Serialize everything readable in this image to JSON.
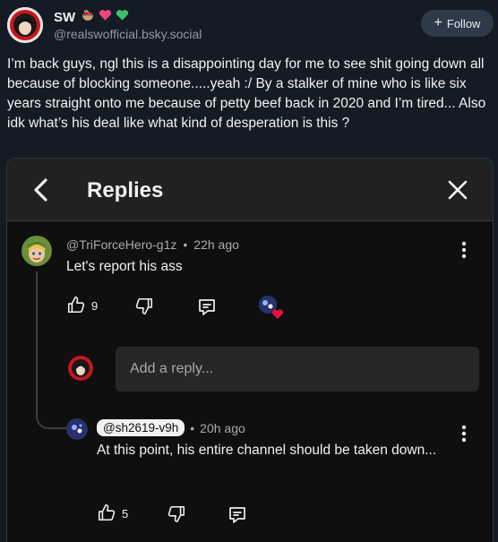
{
  "post": {
    "display_name": "SW",
    "emoji": [
      "ramen-bowl-emoji",
      "pink-heart-emoji",
      "green-heart-emoji"
    ],
    "handle": "@realswofficial.bsky.social",
    "follow_label": "Follow",
    "text": "I’m back guys, ngl this is a disappointing day for me to see shit going down all because of blocking someone.....yeah :/ By a stalker of mine who is like six years straight onto me because of petty beef back in 2020 and I’m tired... Also idk what’s his deal like what kind of desperation is this ?"
  },
  "embed": {
    "header_title": "Replies",
    "comments": [
      {
        "author": "@TriForceHero-g1z",
        "separator": "•",
        "time": "22h ago",
        "text": "Let's report his ass",
        "likes": "9"
      }
    ],
    "reply_input": {
      "placeholder": "Add a reply..."
    },
    "replies": [
      {
        "author": "@sh2619-v9h",
        "separator": "•",
        "time": "20h ago",
        "text": "At this point, his entire channel should be taken down...",
        "likes": "5"
      }
    ]
  },
  "colors": {
    "page_bg": "#141b24",
    "embed_bg": "#0f0f0f",
    "header_bg": "#212121",
    "muted_text": "#8d99a6",
    "creator_heart": "#e0143c"
  }
}
